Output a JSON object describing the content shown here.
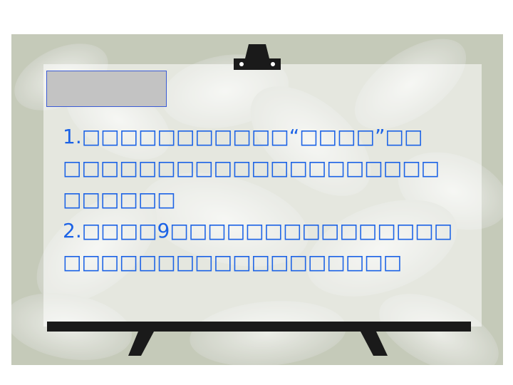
{
  "slide": {
    "title_box_label": "",
    "paragraphs": [
      {
        "number": "1.",
        "lines": [
          "□□□□□□□□□□□“□□□□”□□",
          "□□□□□□□□□□□□□□□□□□□□",
          "□□□□□□"
        ]
      },
      {
        "number": "2.",
        "lines": [
          "□□□□9□□□□□□□□□□□□□□□",
          "□□□□□□□□□□□□□□□□□□"
        ]
      }
    ]
  },
  "colors": {
    "text": "#1c63e6",
    "title_box_fill": "#c3c3c3",
    "title_box_border": "#3b5bd6",
    "easel": "#1a1a1a",
    "background_tint": "#d9ddd0"
  }
}
